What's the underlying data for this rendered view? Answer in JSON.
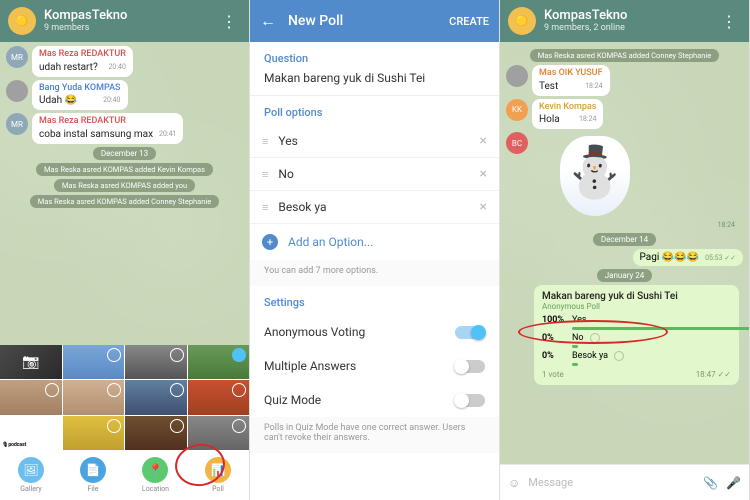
{
  "panel1": {
    "header": {
      "title": "KompasTekno",
      "subtitle": "9 members"
    },
    "messages": [
      {
        "avatar": "MR",
        "name": "Mas Reza REDAKTUR",
        "nameClass": "",
        "text": "udah restart?",
        "time": "20:40"
      },
      {
        "avatar": "",
        "name": "Bang Yuda KOMPAS",
        "nameClass": "b",
        "text": "Udah 😂",
        "time": "20:40"
      },
      {
        "avatar": "MR",
        "name": "Mas Reza REDAKTUR",
        "nameClass": "",
        "text": "coba instal samsung max",
        "time": "20:41"
      }
    ],
    "date": "December 13",
    "system": [
      "Mas Reska asred KOMPAS added Kevin Kompas",
      "Mas Reska asred KOMPAS added you",
      "Mas Reska asred KOMPAS added Conney Stephanie"
    ],
    "attach": [
      {
        "icon": "🖼",
        "label": "Gallery",
        "cls": "gallery-i"
      },
      {
        "icon": "📄",
        "label": "File",
        "cls": "file-i"
      },
      {
        "icon": "📍",
        "label": "Location",
        "cls": "loc-i"
      },
      {
        "icon": "📊",
        "label": "Poll",
        "cls": "poll-i"
      }
    ]
  },
  "panel2": {
    "title": "New Poll",
    "create": "CREATE",
    "questionLabel": "Question",
    "question": "Makan bareng yuk di Sushi Tei",
    "optionsLabel": "Poll options",
    "options": [
      "Yes",
      "No",
      "Besok ya"
    ],
    "addOption": "Add an Option...",
    "hint": "You can add 7 more options.",
    "settingsLabel": "Settings",
    "settings": [
      {
        "label": "Anonymous Voting",
        "on": true
      },
      {
        "label": "Multiple Answers",
        "on": false
      },
      {
        "label": "Quiz Mode",
        "on": false
      }
    ],
    "quizHint": "Polls in Quiz Mode have one correct answer. Users can't revoke their answers."
  },
  "panel3": {
    "header": {
      "title": "KompasTekno",
      "subtitle": "9 members, 2 online"
    },
    "system": "Mas Reska asred KOMPAS added Conney Stephanie",
    "msgs": [
      {
        "avatar": "",
        "avCls": "y",
        "name": "Mas OIK YUSUF",
        "nameCls": "o",
        "text": "Test",
        "time": "18:24"
      },
      {
        "avatar": "KK",
        "avCls": "kk",
        "name": "Kevin Kompas",
        "nameCls": "k",
        "text": "Hola",
        "time": "18:24"
      }
    ],
    "stickerTime": "18:24",
    "bcAvatar": "BC",
    "date1": "December 14",
    "pagi": "Pagi 😂😂😂",
    "pagiTime": "05:53 ✓✓",
    "date2": "January 24",
    "poll": {
      "title": "Makan bareng yuk di Sushi Tei",
      "sub": "Anonymous Poll",
      "opts": [
        {
          "pct": "100%",
          "label": "Yes",
          "bar": 100
        },
        {
          "pct": "0%",
          "label": "No",
          "bar": 3
        },
        {
          "pct": "0%",
          "label": "Besok ya",
          "bar": 3
        }
      ],
      "votes": "1 vote",
      "time": "18:47 ✓✓"
    },
    "placeholder": "Message"
  }
}
